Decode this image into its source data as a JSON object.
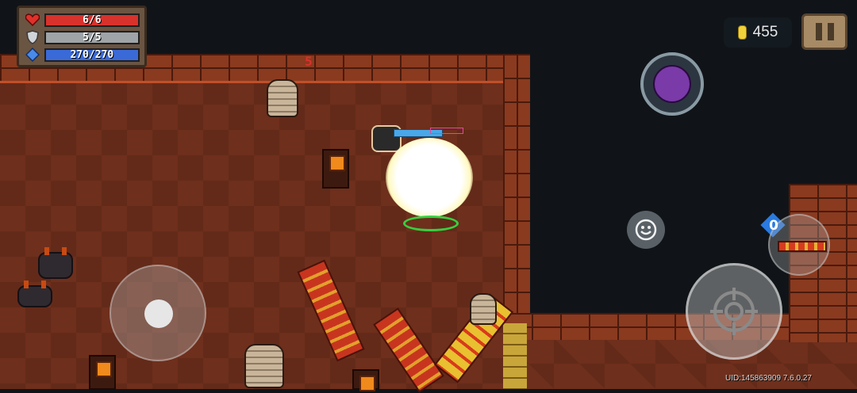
{
  "hud": {
    "health": {
      "label": "6/6",
      "current": 6,
      "max": 6,
      "color": "#d8322c"
    },
    "armor": {
      "label": "5/5",
      "current": 5,
      "max": 5,
      "color": "#9ea4a8"
    },
    "energy": {
      "label": "270/270",
      "current": 270,
      "max": 270,
      "color": "#3a6ad8"
    }
  },
  "coins": {
    "value": "455",
    "icon": "coin-icon"
  },
  "pause": {
    "icon": "pause-icon"
  },
  "boss": {
    "icon": "boss-portrait-icon"
  },
  "emote": {
    "icon": "smiley-icon"
  },
  "weapon": {
    "energy_cost": "0",
    "icon": "weapon-icon"
  },
  "attack": {
    "icon": "crosshair-icon"
  },
  "joystick": {
    "icon": "joystick-icon"
  },
  "map": {
    "room_marker": "5"
  },
  "footer": {
    "uid": "UID:145863909 7.6.0.27"
  },
  "colors": {
    "floor": "#6e2f1c",
    "wall": "#8a3a1f",
    "void": "#101418",
    "accent_gold": "#f2d23a"
  }
}
